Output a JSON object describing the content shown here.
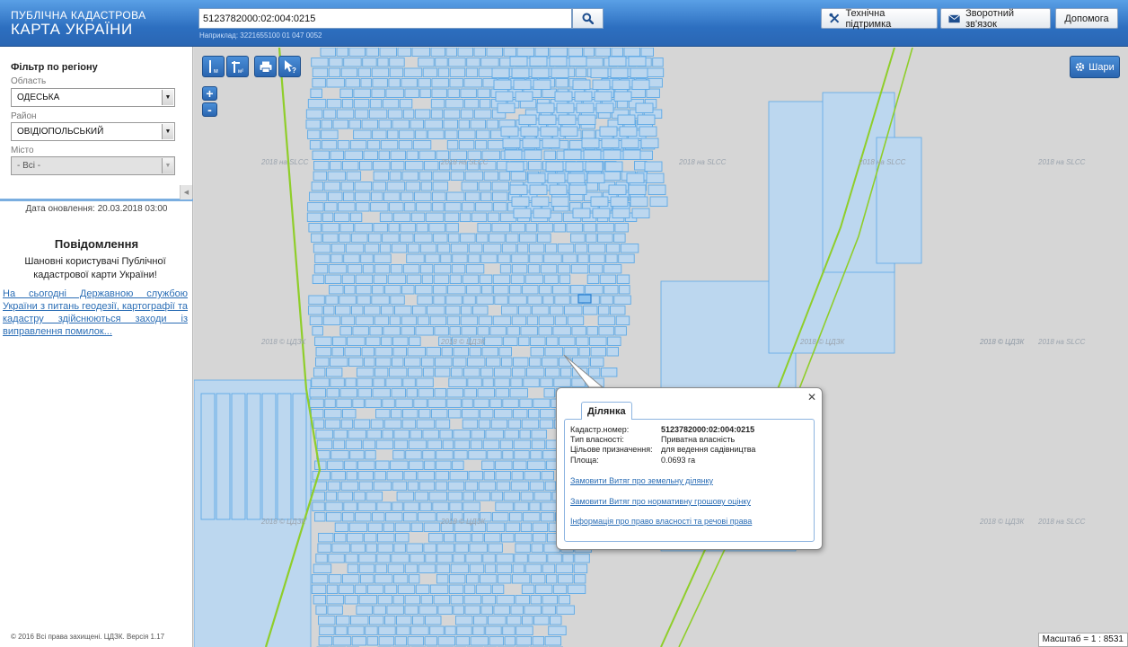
{
  "header": {
    "logo_line1": "ПУБЛІЧНА КАДАСТРОВА",
    "logo_line2": "КАРТА УКРАЇНИ",
    "search_value": "5123782000:02:004:0215",
    "search_hint": "Наприклад: 3221655100 01 047 0052",
    "buttons": {
      "support": "Технічна підтримка",
      "feedback": "Зворотний зв'язок",
      "help": "Допомога"
    }
  },
  "sidebar": {
    "filter_title": "Фільтр по регіону",
    "region_label": "Область",
    "region_value": "ОДЕСЬКА",
    "district_label": "Район",
    "district_value": "ОВІДІОПОЛЬСЬКИЙ",
    "city_label": "Місто",
    "city_value": "- Всі -",
    "update_date": "Дата оновлення: 20.03.2018 03:00",
    "news_title": "Повідомлення",
    "news_text": "Шановні користувачі Публічної кадастрової карти України!",
    "news_link": "На сьогодні Державною службою України з питань геодезії, картографії та кадастру здійснюються заходи із виправлення помилок...",
    "copyright": "© 2016 Всі права захищені. ЦДЗК. Версія 1.17"
  },
  "map": {
    "tools": {
      "measure_length": "м",
      "measure_area": "м²",
      "zoom_in": "+",
      "zoom_out": "-"
    },
    "layers_label": "Шари",
    "scale": "Масштаб = 1 : 8531",
    "watermark_a": "2018 © ЦДЗК",
    "watermark_b": "2018 на SLCC",
    "colors": {
      "parcel_fill": "#bcd7ef",
      "parcel_stroke": "#5da9e6",
      "road_green": "#8fce2a",
      "header_blue": "#2d6fc0"
    }
  },
  "popup": {
    "tab": "Ділянка",
    "rows": [
      {
        "key": "Кадастр.номер:",
        "value": "5123782000:02:004:0215"
      },
      {
        "key": "Тип власності:",
        "value": "Приватна власність"
      },
      {
        "key": "Цільове призначення:",
        "value": "для ведення садівництва"
      },
      {
        "key": "Площа:",
        "value": "0.0693 га"
      }
    ],
    "links": [
      "Замовити Витяг про земельну ділянку",
      "Замовити Витяг про нормативну грошову оцінку",
      "Інформація про право власності та речові права"
    ]
  }
}
